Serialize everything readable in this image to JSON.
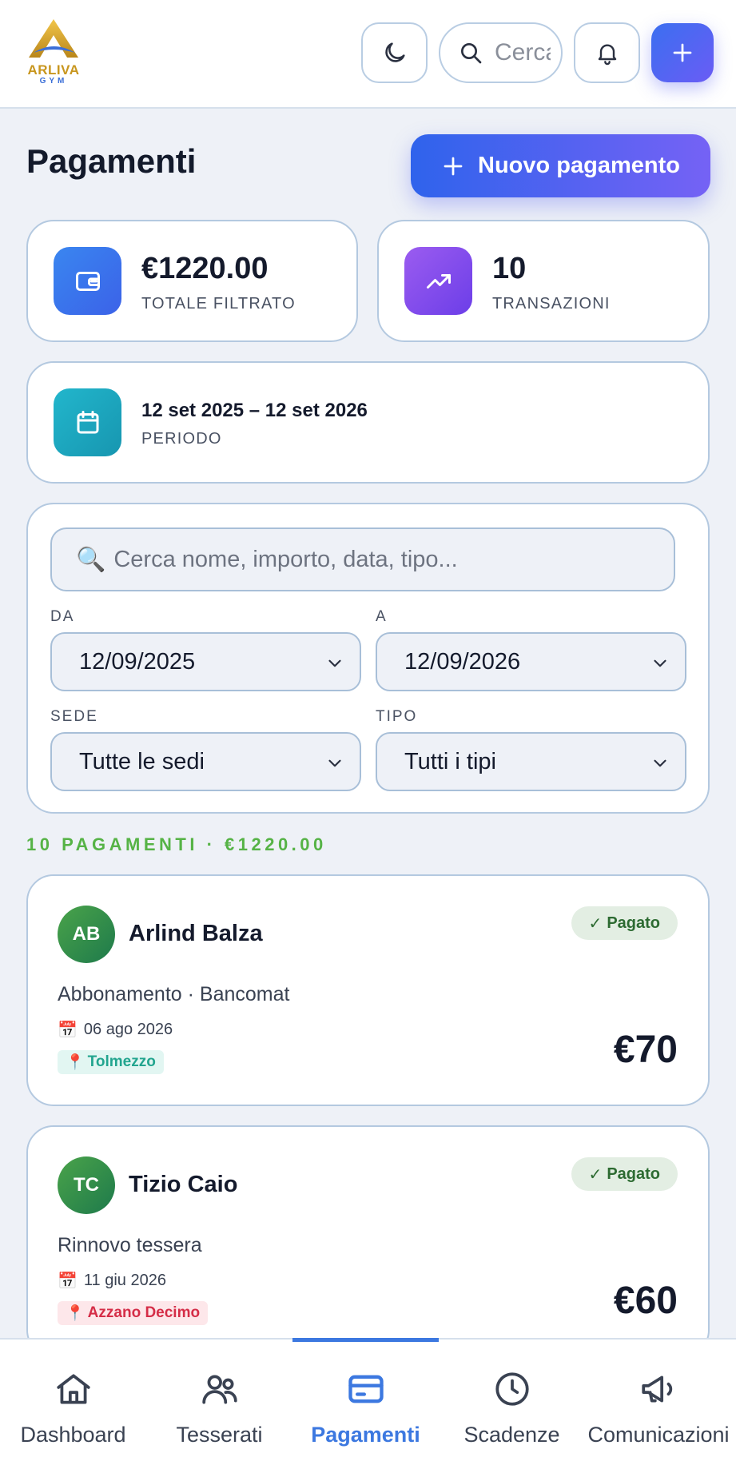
{
  "brand": {
    "name": "ARLIVA",
    "sub": "GYM"
  },
  "header": {
    "search_placeholder": "Cerca",
    "icons": [
      "moon-icon",
      "search-icon",
      "bell-icon",
      "plus-icon"
    ]
  },
  "page": {
    "title": "Pagamenti",
    "new_payment_label": "Nuovo pagamento"
  },
  "stats": {
    "total_value": "€1220.00",
    "total_label": "TOTALE FILTRATO",
    "transactions_value": "10",
    "transactions_label": "TRANSAZIONI",
    "period_value": "12 set 2025 – 12 set 2026",
    "period_label": "PERIODO"
  },
  "filters": {
    "search_placeholder": "Cerca nome, importo, data, tipo...",
    "from_label": "DA",
    "from_value": "12/09/2025",
    "to_label": "A",
    "to_value": "12/09/2026",
    "site_label": "SEDE",
    "site_value": "Tutte le sedi",
    "type_label": "TIPO",
    "type_value": "Tutti i tipi"
  },
  "summary": "10 PAGAMENTI · €1220.00",
  "payments": [
    {
      "initials": "AB",
      "name": "Arlind Balza",
      "status": "Pagato",
      "description": "Abbonamento · Bancomat",
      "date": "06 ago 2026",
      "location": "Tolmezzo",
      "location_color": "#22a58f",
      "amount": "€70"
    },
    {
      "initials": "TC",
      "name": "Tizio Caio",
      "status": "Pagato",
      "description": "Rinnovo tessera",
      "date": "11 giu 2026",
      "location": "Azzano Decimo",
      "location_color": "#d52d47",
      "amount": "€60"
    }
  ],
  "nav": {
    "items": [
      {
        "label": "Dashboard",
        "icon": "home-icon"
      },
      {
        "label": "Tesserati",
        "icon": "users-icon"
      },
      {
        "label": "Pagamenti",
        "icon": "credit-card-icon",
        "active": true
      },
      {
        "label": "Scadenze",
        "icon": "clock-icon"
      },
      {
        "label": "Comunicazioni",
        "icon": "megaphone-icon"
      }
    ]
  },
  "colors": {
    "accent": "#3c78e0",
    "summary": "#56b346",
    "status_bg": "#e3eee3",
    "status_text": "#2d6b32"
  }
}
